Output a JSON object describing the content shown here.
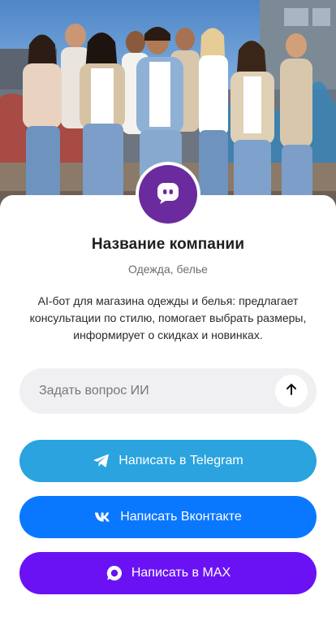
{
  "hero": {
    "image": "group-fashion-photo"
  },
  "company": {
    "avatar_icon": "chat-bubble-icon",
    "name": "Название компании",
    "category": "Одежда, белье",
    "description": "AI-бот для магазина одежды и белья: предлагает консультации по стилю, помогает выбрать размеры, информирует о скидках и новинках."
  },
  "ask": {
    "placeholder": "Задать вопрос ИИ",
    "value": "",
    "send_icon": "arrow-up-icon"
  },
  "buttons": {
    "telegram": {
      "label": "Написать в Telegram",
      "icon": "telegram-icon",
      "color": "#2aa3de"
    },
    "vk": {
      "label": "Написать Вконтакте",
      "icon": "vk-icon",
      "color": "#0a77ff"
    },
    "max": {
      "label": "Написать в MAX",
      "icon": "max-icon",
      "color": "#6b12f5"
    }
  },
  "colors": {
    "avatar_bg": "#6b2a9e",
    "ask_field_bg": "#f0f0f2"
  }
}
